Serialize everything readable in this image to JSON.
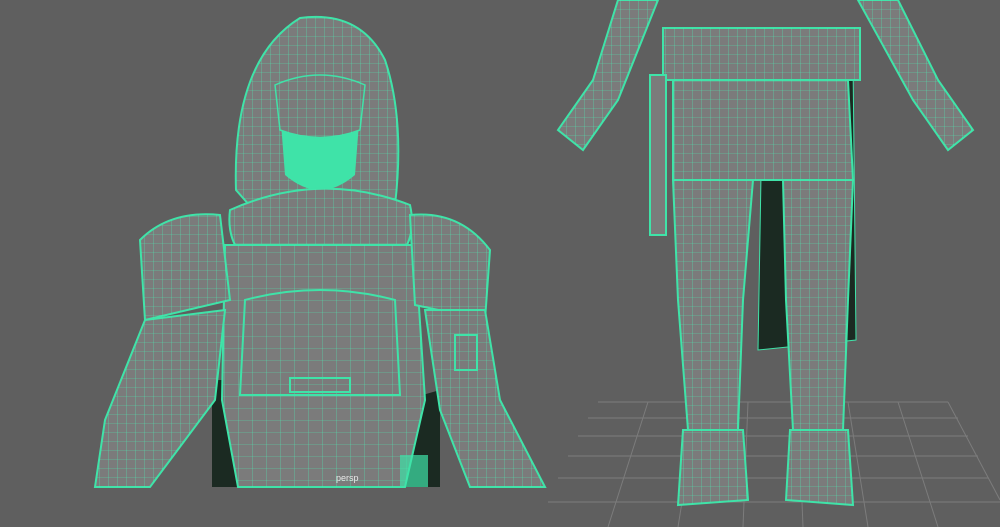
{
  "viewports": [
    {
      "id": "left",
      "camera_label": "persp",
      "content": "wireframe-character-upper-body"
    },
    {
      "id": "right",
      "camera_label": "",
      "content": "wireframe-character-full-body"
    }
  ],
  "colors": {
    "viewport_bg": "#5f5f5f",
    "mesh_fill": "#7a7a7a",
    "wire": "#3fe3a8",
    "grid": "#7c7c7c",
    "cape": "#1a2a22"
  }
}
